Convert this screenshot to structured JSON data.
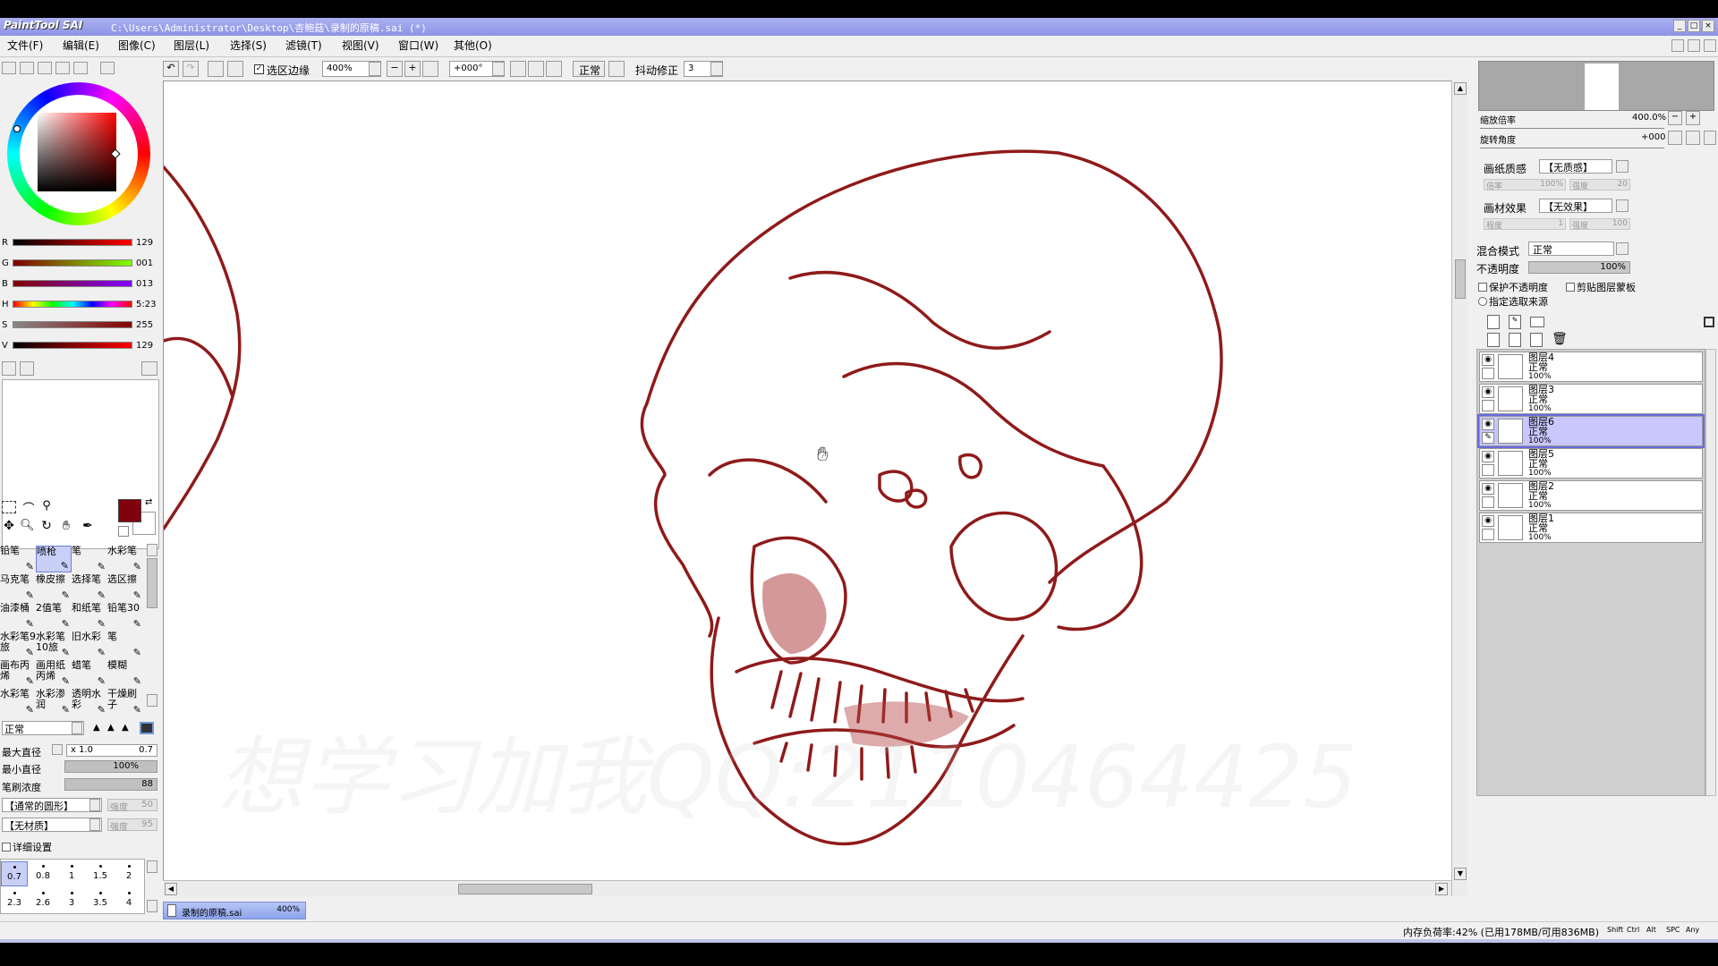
{
  "app": {
    "logo": "PaintTool SAI",
    "title": "C:\\Users\\Administrator\\Desktop\\杏鲍菇\\录制的原稿.sai (*)"
  },
  "menu": [
    "文件(F)",
    "编辑(E)",
    "图像(C)",
    "图层(L)",
    "选择(S)",
    "滤镜(T)",
    "视图(V)",
    "窗口(W)",
    "其他(O)"
  ],
  "toolbar": {
    "selection_edge_label": "选区边缘",
    "zoom": "400%",
    "rotation": "+000°",
    "blend": "正常",
    "stabilizer_label": "抖动修正",
    "stabilizer_value": "3"
  },
  "color": {
    "accent": "#81010d",
    "sliders": [
      {
        "label": "R",
        "value": "129"
      },
      {
        "label": "G",
        "value": "001"
      },
      {
        "label": "B",
        "value": "013"
      },
      {
        "label": "H",
        "value": "5:23"
      },
      {
        "label": "S",
        "value": "255"
      },
      {
        "label": "V",
        "value": "129"
      }
    ]
  },
  "tools": {
    "brushes": [
      [
        "铅笔",
        "喷枪",
        "笔",
        "水彩笔"
      ],
      [
        "马克笔",
        "橡皮擦",
        "选择笔",
        "选区擦"
      ],
      [
        "油漆桶",
        "2值笔",
        "和纸笔",
        "铅笔30"
      ],
      [
        "水彩笔9旅",
        "水彩笔10旅",
        "旧水彩",
        "笔"
      ],
      [
        "画布丙烯",
        "画用纸丙烯",
        "蜡笔",
        "模糊"
      ],
      [
        "水彩笔",
        "水彩渗润",
        "透明水彩",
        "干燥刷子"
      ]
    ],
    "mode": "正常",
    "max_size_label": "最大直径",
    "max_size_value": "x 1.0",
    "max_size_num": "0.7",
    "min_size_label": "最小直径",
    "min_size_value": "100%",
    "density_label": "笔刷浓度",
    "density_value": "88",
    "shape": "【通常的圆形】",
    "shape_strength_label": "强度",
    "shape_strength_value": "50",
    "texture": "【无材质】",
    "texture_strength_label": "强度",
    "texture_strength_value": "95",
    "detail_label": "详细设置",
    "sizes": [
      "0.7",
      "0.8",
      "1",
      "1.5",
      "2",
      "2.3",
      "2.6",
      "3",
      "3.5",
      "4"
    ]
  },
  "canvas": {
    "watermark": "想学习加我QQ:2110464425",
    "doc_tab": "录制的原稿.sai",
    "doc_zoom": "400%"
  },
  "navigator": {
    "zoom_label": "缩放倍率",
    "zoom_value": "400.0%",
    "angle_label": "旋转角度",
    "angle_value": "+000"
  },
  "layer_props": {
    "paper_label": "画纸质感",
    "paper_value": "【无质感】",
    "paper_scale": "倍率",
    "paper_scale_value": "100%",
    "paper_strength": "强度",
    "paper_strength_value": "20",
    "effect_label": "画材效果",
    "effect_value": "【无效果】",
    "effect_degree": "程度",
    "effect_degree_value": "1",
    "effect_strength": "强度",
    "effect_strength_value": "100",
    "blend_label": "混合模式",
    "blend_value": "正常",
    "opacity_label": "不透明度",
    "opacity_value": "100%",
    "protect_label": "保护不透明度",
    "clip_label": "剪贴图层蒙板",
    "source_label": "指定选取来源"
  },
  "layers": [
    {
      "name": "图层4",
      "mode": "正常",
      "opacity": "100%",
      "selected": false
    },
    {
      "name": "图层3",
      "mode": "正常",
      "opacity": "100%",
      "selected": false
    },
    {
      "name": "图层6",
      "mode": "正常",
      "opacity": "100%",
      "selected": true
    },
    {
      "name": "图层5",
      "mode": "正常",
      "opacity": "100%",
      "selected": false
    },
    {
      "name": "图层2",
      "mode": "正常",
      "opacity": "100%",
      "selected": false
    },
    {
      "name": "图层1",
      "mode": "正常",
      "opacity": "100%",
      "selected": false
    }
  ],
  "status": {
    "memory": "内存负荷率:42% (已用178MB/可用836MB)",
    "keys": [
      "Shift",
      "Ctrl",
      "Alt",
      "SPC",
      "Any"
    ]
  }
}
